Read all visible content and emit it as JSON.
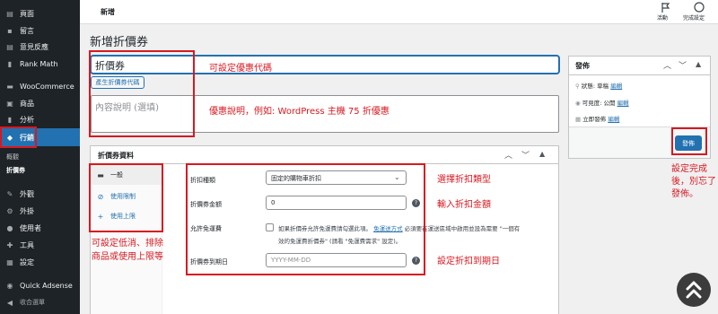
{
  "sidebar": {
    "items": [
      {
        "icon": "pages-icon",
        "glyph": "▤",
        "label": "頁面"
      },
      {
        "icon": "comments-icon",
        "glyph": "▪",
        "label": "留言"
      },
      {
        "icon": "feedback-icon",
        "glyph": "▤",
        "label": "意見反應"
      },
      {
        "icon": "rankmath-icon",
        "glyph": "▮",
        "label": "Rank Math"
      },
      {
        "icon": "woocommerce-icon",
        "glyph": "▬",
        "label": "WooCommerce"
      },
      {
        "icon": "products-icon",
        "glyph": "▣",
        "label": "商品"
      },
      {
        "icon": "analytics-icon",
        "glyph": "▮",
        "label": "分析"
      },
      {
        "icon": "marketing-icon",
        "glyph": "◆",
        "label": "行銷"
      },
      {
        "icon": "appearance-icon",
        "glyph": "✎",
        "label": "外觀"
      },
      {
        "icon": "plugins-icon",
        "glyph": "⚙",
        "label": "外掛"
      },
      {
        "icon": "users-icon",
        "glyph": "●",
        "label": "使用者"
      },
      {
        "icon": "tools-icon",
        "glyph": "✚",
        "label": "工具"
      },
      {
        "icon": "settings-icon",
        "glyph": "▦",
        "label": "設定"
      },
      {
        "icon": "quick-adsense-icon",
        "glyph": "◉",
        "label": "Quick Adsense"
      },
      {
        "icon": "collapse-menu-icon",
        "glyph": "◀",
        "label": "收合選單"
      }
    ],
    "sub": [
      "概觀",
      "折價券"
    ]
  },
  "topbar": {
    "title": "新增",
    "activity": "活動",
    "finish": "完成設定"
  },
  "page_title": "新增折價券",
  "coupon_code": {
    "value": "折價券"
  },
  "generate_button": "產生折價券代碼",
  "description": {
    "placeholder": "內容說明 (選填)"
  },
  "coupon_data": {
    "title": "折價券資料",
    "tabs": [
      "一般",
      "使用限制",
      "使用上限"
    ],
    "discount_type_label": "折扣種類",
    "discount_type_value": "固定的購物車折扣",
    "amount_label": "折價券金額",
    "amount_value": "0",
    "free_shipping_label": "允許免運費",
    "free_shipping_text1": "如果折價券允許免運費請勾選此項。",
    "free_shipping_link": "免運送方式",
    "free_shipping_text2": "必須要在運送區域中啟用並設為需要 \"一個有",
    "free_shipping_text3": "效的免運費折價券\" (請看 \"免運費需求\" 設定)。",
    "expiry_label": "折價券到期日",
    "expiry_placeholder": "YYYY-MM-DD"
  },
  "publish": {
    "title": "發佈",
    "status": "狀態: 草稿",
    "visibility": "可見度: 公開",
    "schedule": "立即發佈",
    "edit": "編輯",
    "button": "發佈"
  },
  "annotations": {
    "code": "可設定優惠代碼",
    "desc": "優惠說明，例如: WordPress 主機 75 折優惠",
    "type": "選擇折扣類型",
    "amount": "輸入折扣金額",
    "expiry": "設定折扣到期日",
    "limits": [
      "可設定低消、排除",
      "商品或使用上限等"
    ],
    "publish": [
      "設定完成",
      "後，別忘了",
      "發佈。"
    ]
  },
  "colors": {
    "sidebar": "#1d2327",
    "active": "#2271b1",
    "annotation": "#d71920"
  }
}
